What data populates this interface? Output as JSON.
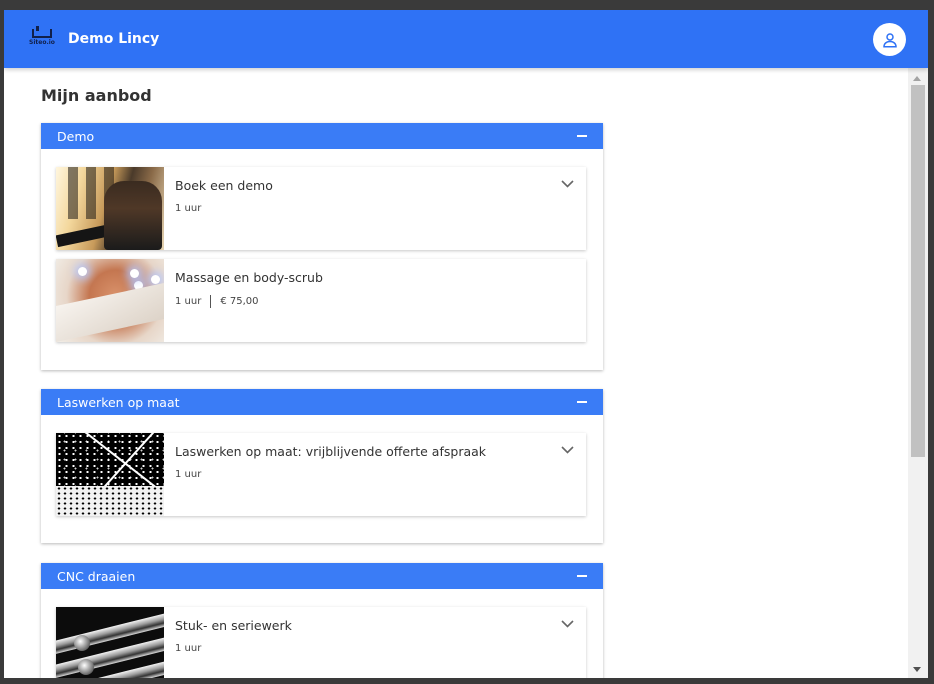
{
  "app": {
    "logo_text": "Siteo.io",
    "title": "Demo Lincy",
    "user_icon": "user-icon"
  },
  "page": {
    "title": "Mijn aanbod"
  },
  "sections": [
    {
      "title": "Demo",
      "collapse_icon": "minus-icon",
      "items": [
        {
          "title": "Boek een demo",
          "duration": "1 uur",
          "price": null,
          "expand_icon": "chevron-down-icon"
        },
        {
          "title": "Massage en body-scrub",
          "duration": "1 uur",
          "price": "€ 75,00"
        }
      ]
    },
    {
      "title": "Laswerken op maat",
      "collapse_icon": "minus-icon",
      "items": [
        {
          "title": "Laswerken op maat: vrijblijvende offerte afspraak",
          "duration": "1 uur",
          "price": null,
          "expand_icon": "chevron-down-icon"
        }
      ]
    },
    {
      "title": "CNC draaien",
      "collapse_icon": "minus-icon",
      "items": [
        {
          "title": "Stuk- en seriewerk",
          "duration": "1 uur",
          "price": null,
          "expand_icon": "chevron-down-icon"
        }
      ]
    }
  ],
  "colors": {
    "header": "#2f72f5",
    "section_header": "#3a7cf6"
  }
}
